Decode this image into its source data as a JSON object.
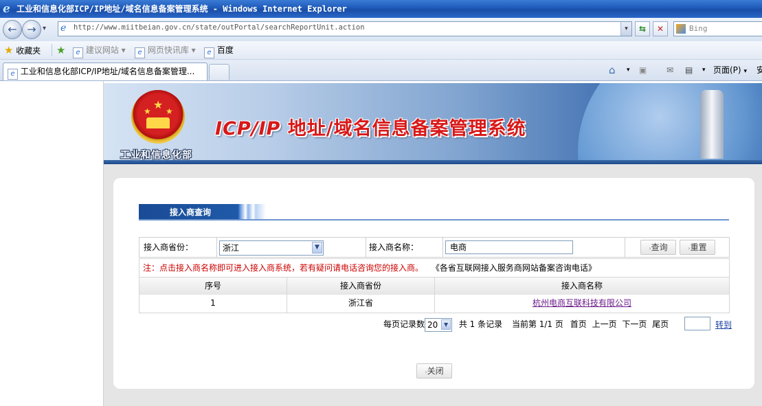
{
  "window": {
    "title": "工业和信息化部ICP/IP地址/域名信息备案管理系统 - Windows Internet Explorer"
  },
  "browser": {
    "url": "http://www.miitbeian.gov.cn/state/outPortal/searchReportUnit.action",
    "search_placeholder": "Bing",
    "favorites": {
      "label": "收藏夹",
      "items": [
        "建议网站 ▾",
        "网页快讯库 ▾",
        "百度"
      ]
    },
    "tab_title": "工业和信息化部ICP/IP地址/域名信息备案管理...",
    "commands": {
      "page_menu": "页面(P)",
      "safety_partial": "安"
    }
  },
  "banner": {
    "ministry": "工业和信息化部",
    "title_latin": "ICP/IP",
    "title_cjk": " 地址/域名信息备案管理系统"
  },
  "section": {
    "title": "接入商查询"
  },
  "query": {
    "province_label": "接入商省份：",
    "province_value": "浙江",
    "name_label": "接入商名称：",
    "name_value": "电商",
    "search_button": "查询",
    "reset_button": "重置"
  },
  "notes": {
    "warning": "注：点击接入商名称即可进入接入商系统，若有疑问请电话咨询您的接入商。",
    "link": "《各省互联网接入服务商网站备案咨询电话》"
  },
  "table": {
    "headers": [
      "序号",
      "接入商省份",
      "接入商名称"
    ],
    "rows": [
      {
        "index": "1",
        "province": "浙江省",
        "name": "杭州电商互联科技有限公司"
      }
    ]
  },
  "pager": {
    "per_page_label": "每页记录数",
    "per_page_value": "20",
    "total": "共 1 条记录",
    "current": "当前第 1/1 页",
    "first": "首页",
    "prev": "上一页",
    "next": "下一页",
    "last": "尾页",
    "goto": "转到"
  },
  "close_button": "关闭",
  "colors": {
    "title_red": "#d81818",
    "section_blue": "#1a4b96",
    "visited_link": "#6a1a8a"
  }
}
